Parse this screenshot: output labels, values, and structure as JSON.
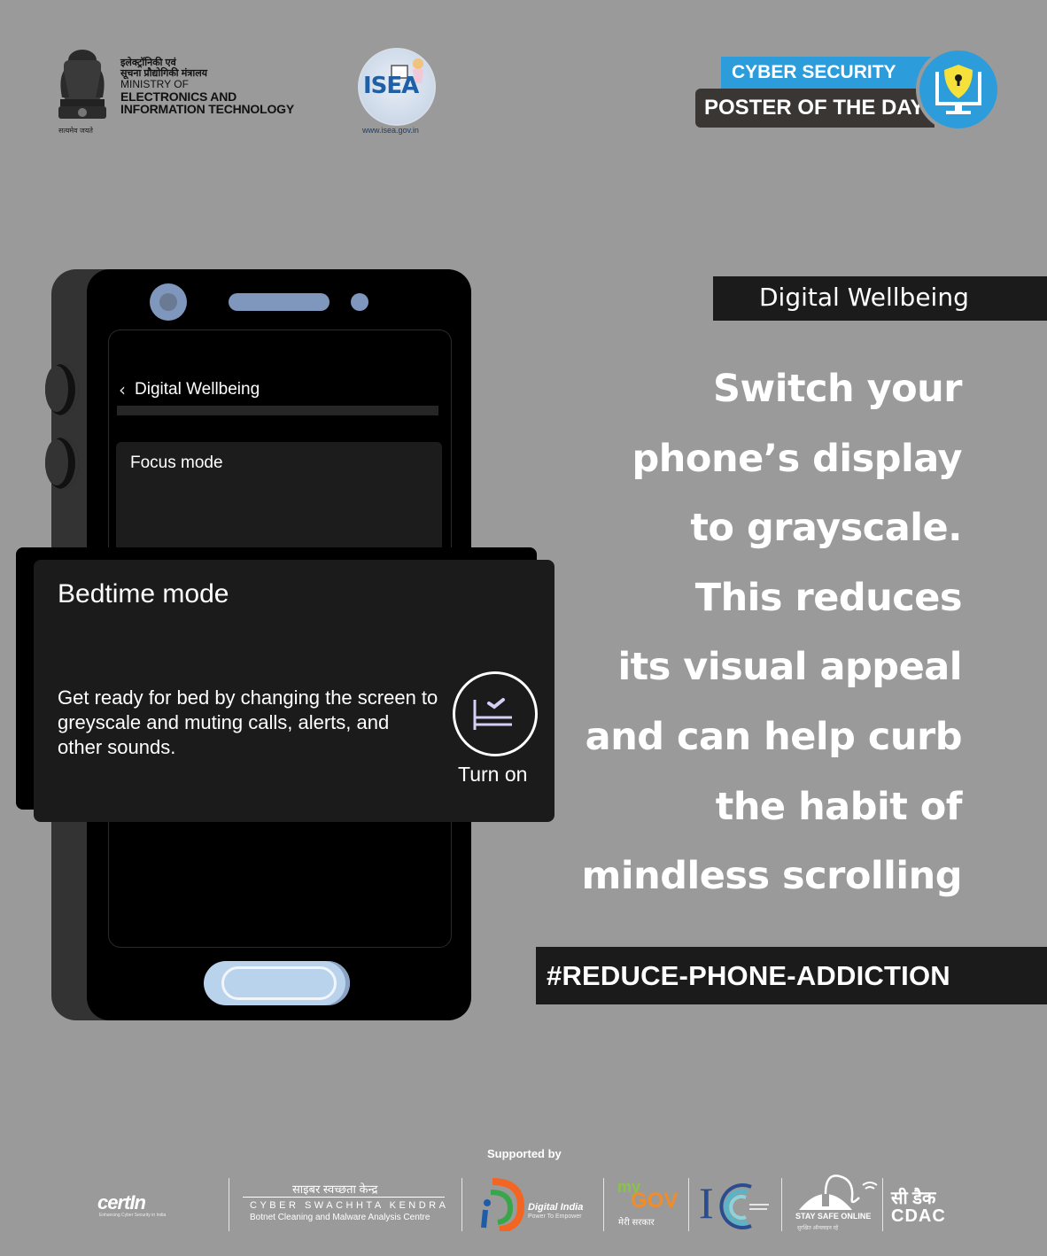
{
  "header": {
    "ministry": {
      "hindi_line1": "इलेक्ट्रॉनिकी एवं",
      "hindi_line2": "सूचना प्रौद्योगिकी मंत्रालय",
      "line_ministry_of": "MINISTRY OF",
      "line_electronics": "ELECTRONICS AND",
      "line_it": "INFORMATION TECHNOLOGY",
      "motto": "सत्यमेव जयते"
    },
    "isea": {
      "logo_text": "ISEA",
      "url": "www.isea.gov.in"
    },
    "badge": {
      "top": "CYBER SECURITY",
      "bottom": "POSTER OF THE DAY",
      "icon": "shield-lock-monitor-icon",
      "colors": {
        "blue": "#2d9cdb",
        "dark": "#3a3633",
        "shield": "#f5e13a"
      }
    }
  },
  "phone": {
    "screen_title": "Digital Wellbeing",
    "back_icon": "chevron-left-icon",
    "focus_card_label": "Focus mode",
    "bedtime_card": {
      "title": "Bedtime mode",
      "description": "Get ready for bed by changing the screen to greyscale and muting calls, alerts, and other sounds.",
      "action_label": "Turn on",
      "action_icon": "bed-check-icon"
    },
    "colors": {
      "accent": "#7f97bd",
      "home_button": "#b9d3ed"
    }
  },
  "content": {
    "tag": "Digital Wellbeing",
    "headline_lines": [
      "Switch your",
      "phone’s display",
      "to grayscale.",
      "This reduces",
      "its visual appeal",
      "and can help curb",
      "the habit of",
      "mindless scrolling"
    ],
    "hashtag": "#REDUCE-PHONE-ADDICTION"
  },
  "footer": {
    "supported_by": "Supported by",
    "logos": {
      "cert_in": {
        "name": "cert-in",
        "tagline": "Enhancing Cyber Security in India"
      },
      "csk": {
        "hindi": "साइबर स्वच्छता केन्द्र",
        "english": "CYBER SWACHHTA KENDRA",
        "sub": "Botnet Cleaning and Malware Analysis Centre"
      },
      "digital_india": {
        "title": "Digital India",
        "tagline": "Power To Empower"
      },
      "mygov": {
        "my": "my",
        "gov": "GOV",
        "hindi": "मेरी सरकार"
      },
      "i4c": {
        "letter": "I"
      },
      "stay_safe_online": {
        "title": "STAY SAFE ONLINE",
        "sub": "सुरक्षित ऑनलाइन रहें"
      },
      "cdac": {
        "hindi": "सी डैक",
        "english": "CDAC"
      }
    }
  }
}
